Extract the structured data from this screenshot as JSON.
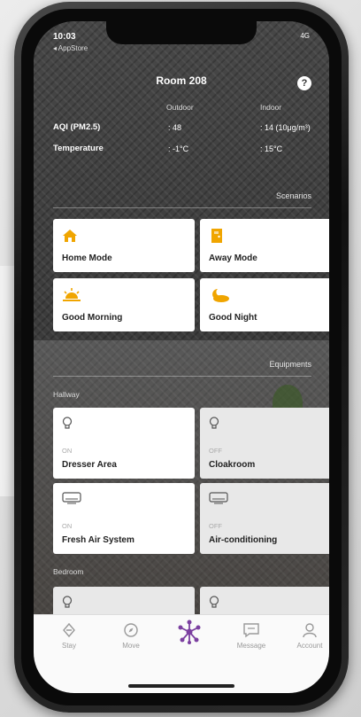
{
  "status_bar": {
    "time": "10:03",
    "back_label": "◂ AppStore",
    "signal": "4G"
  },
  "header": {
    "title": "Room 208",
    "help_label": "?"
  },
  "env": {
    "outdoor_label": "Outdoor",
    "indoor_label": "Indoor",
    "rows": [
      {
        "label": "AQI (PM2.5)",
        "outdoor": ": 48",
        "indoor": ": 14 (10μg/m³)"
      },
      {
        "label": "Temperature",
        "outdoor": ": -1°C",
        "indoor": ": 15°C"
      }
    ]
  },
  "scenarios": {
    "title": "Scenarios",
    "items": [
      {
        "label": "Home Mode",
        "icon": "house-icon"
      },
      {
        "label": "Away Mode",
        "icon": "door-icon"
      },
      {
        "label": "Good Morning",
        "icon": "sunrise-icon"
      },
      {
        "label": "Good Night",
        "icon": "moon-cloud-icon"
      }
    ]
  },
  "equipments": {
    "title": "Equipments",
    "groups": [
      {
        "name": "Hallway",
        "items": [
          {
            "label": "Dresser Area",
            "state": "ON",
            "icon": "bulb-icon"
          },
          {
            "label": "Cloakroom",
            "state": "OFF",
            "icon": "bulb-icon"
          },
          {
            "label": "Fresh Air System",
            "state": "ON",
            "icon": "air-unit-icon"
          },
          {
            "label": "Air-conditioning",
            "state": "OFF",
            "icon": "air-unit-icon"
          }
        ]
      },
      {
        "name": "Bedroom",
        "items": [
          {
            "icon": "bulb-icon"
          },
          {
            "icon": "bulb-icon"
          }
        ]
      }
    ]
  },
  "tabbar": {
    "items": [
      {
        "label": "Stay",
        "icon": "stay-icon"
      },
      {
        "label": "Move",
        "icon": "compass-icon"
      },
      {
        "label": "",
        "icon": "hub-icon"
      },
      {
        "label": "Message",
        "icon": "message-icon"
      },
      {
        "label": "Account",
        "icon": "account-icon"
      }
    ]
  },
  "colors": {
    "accent": "#f0a500",
    "hub": "#7b3fa0"
  }
}
